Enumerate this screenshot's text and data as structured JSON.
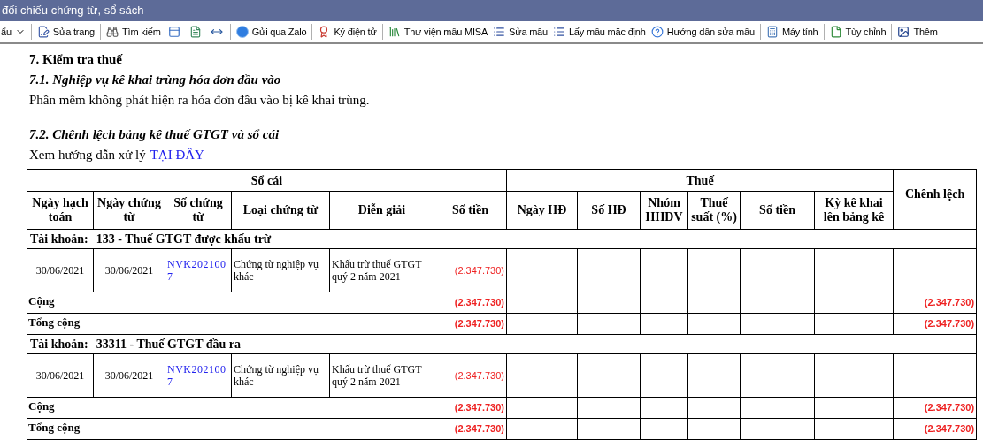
{
  "window": {
    "title": "đối chiếu chứng từ, sổ sách"
  },
  "toolbar": [
    {
      "kind": "dropdown",
      "label": "ẩu"
    },
    {
      "kind": "separator"
    },
    {
      "kind": "button",
      "label": "Sửa trang"
    },
    {
      "kind": "separator"
    },
    {
      "kind": "button",
      "label": "Tìm kiếm"
    },
    {
      "kind": "icon"
    },
    {
      "kind": "icon"
    },
    {
      "kind": "icon"
    },
    {
      "kind": "separator"
    },
    {
      "kind": "button",
      "label": "Gửi qua Zalo"
    },
    {
      "kind": "separator"
    },
    {
      "kind": "button",
      "label": "Ký điện tử"
    },
    {
      "kind": "separator"
    },
    {
      "kind": "button",
      "label": "Thư viện mẫu MISA"
    },
    {
      "kind": "button",
      "label": "Sửa mẫu"
    },
    {
      "kind": "button",
      "label": "Lấy mẫu mặc định"
    },
    {
      "kind": "button",
      "label": "Hướng dẫn sửa mẫu"
    },
    {
      "kind": "separator"
    },
    {
      "kind": "button",
      "label": "Máy tính"
    },
    {
      "kind": "separator"
    },
    {
      "kind": "button",
      "label": "Tùy chỉnh"
    },
    {
      "kind": "separator"
    },
    {
      "kind": "button",
      "label": "Thêm"
    }
  ],
  "report": {
    "heading": "7. Kiểm tra thuế",
    "subsection_1": {
      "title": "7.1. Nghiệp vụ kê khai trùng hóa đơn đầu vào",
      "text": "Phần mềm không phát hiện ra hóa đơn đầu vào bị kê khai trùng."
    },
    "subsection_2": {
      "title": "7.2. Chênh lệch bảng kê thuế GTGT và sổ cái",
      "guide_text": "Xem hướng dẫn xử lý",
      "guide_link": "TẠI ĐÂY"
    },
    "table": {
      "group_headers": [
        "Sổ cái",
        "Thuế",
        "Chênh lệch"
      ],
      "ledger_columns": [
        "Ngày hạch toán",
        "Ngày chứng từ",
        "Số chứng từ",
        "Loại chứng từ",
        "Diễn giải",
        "Số tiền"
      ],
      "tax_columns": [
        "Ngày HĐ",
        "Số HĐ",
        "Nhóm HHDV",
        "Thuế suất (%)",
        "Số tiền",
        "Kỳ kê khai lên bảng kê"
      ],
      "sections": [
        {
          "account_label": "Tài khoản:",
          "account": "133 - Thuế GTGT được khấu trừ",
          "rows": [
            {
              "posting_date": "30/06/2021",
              "voucher_date": "30/06/2021",
              "voucher_no": "NVK2021007",
              "voucher_type": "Chứng từ nghiệp vụ khác",
              "description": "Khấu trừ thuế GTGT quý 2 năm 2021",
              "amount": "(2.347.730)"
            }
          ],
          "subtotal": {
            "label": "Cộng",
            "amount": "(2.347.730)",
            "difference": "(2.347.730)"
          },
          "total": {
            "label": "Tổng cộng",
            "amount": "(2.347.730)",
            "difference": "(2.347.730)"
          }
        },
        {
          "account_label": "Tài khoản:",
          "account": "33311 - Thuế GTGT đầu ra",
          "rows": [
            {
              "posting_date": "30/06/2021",
              "voucher_date": "30/06/2021",
              "voucher_no": "NVK2021007",
              "voucher_type": "Chứng từ nghiệp vụ khác",
              "description": "Khấu trừ thuế GTGT quý 2 năm 2021",
              "amount": "(2.347.730)"
            }
          ],
          "subtotal": {
            "label": "Cộng",
            "amount": "(2.347.730)",
            "difference": "(2.347.730)"
          },
          "total": {
            "label": "Tổng cộng",
            "amount": "(2.347.730)",
            "difference": "(2.347.730)"
          }
        }
      ]
    }
  }
}
